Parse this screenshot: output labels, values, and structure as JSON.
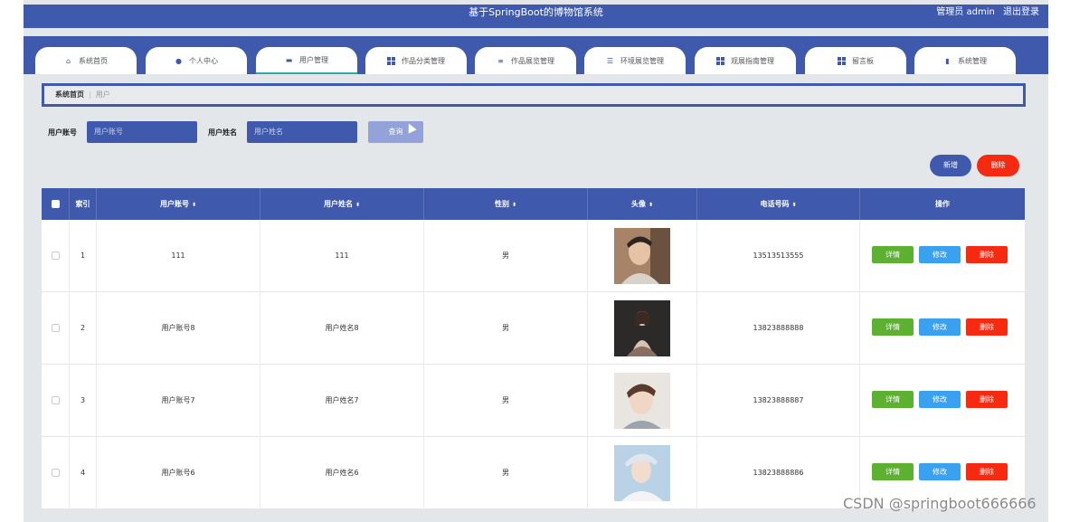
{
  "header": {
    "title": "基于SpringBoot的博物馆系统",
    "user_label": "管理员 admin",
    "logout": "退出登录"
  },
  "nav": {
    "tabs": [
      {
        "label": "系统首页",
        "icon": "home-icon"
      },
      {
        "label": "个人中心",
        "icon": "user-icon"
      },
      {
        "label": "用户管理",
        "icon": "briefcase-icon"
      },
      {
        "label": "作品分类管理",
        "icon": "grid-icon"
      },
      {
        "label": "作品展览管理",
        "icon": "list-icon"
      },
      {
        "label": "环境展览管理",
        "icon": "sliders-icon"
      },
      {
        "label": "观展指南管理",
        "icon": "grid-icon"
      },
      {
        "label": "留言板",
        "icon": "grid-icon"
      },
      {
        "label": "系统管理",
        "icon": "chart-icon"
      }
    ],
    "active_index": 2
  },
  "breadcrumb": {
    "home": "系统首页",
    "current": "用户"
  },
  "search": {
    "account_label": "用户账号",
    "account_placeholder": "用户账号",
    "name_label": "用户姓名",
    "name_placeholder": "用户姓名",
    "query_label": "查询"
  },
  "actions": {
    "add_label": "新增",
    "delete_label": "删除"
  },
  "table": {
    "headers": {
      "index": "索引",
      "account": "用户账号",
      "name": "用户姓名",
      "gender": "性别",
      "avatar": "头像",
      "phone": "电话号码",
      "ops": "操作"
    },
    "sort_symbol": "⬍",
    "rows": [
      {
        "index": "1",
        "account": "111",
        "name": "111",
        "gender": "男",
        "phone": "13513513555"
      },
      {
        "index": "2",
        "account": "用户账号8",
        "name": "用户姓名8",
        "gender": "男",
        "phone": "13823888888"
      },
      {
        "index": "3",
        "account": "用户账号7",
        "name": "用户姓名7",
        "gender": "男",
        "phone": "13823888887"
      },
      {
        "index": "4",
        "account": "用户账号6",
        "name": "用户姓名6",
        "gender": "男",
        "phone": "13823888886"
      }
    ],
    "row_ops": {
      "detail": "详情",
      "edit": "修改",
      "delete": "删除"
    }
  },
  "watermark": "CSDN @springboot666666",
  "colors": {
    "primary": "#3f5aac",
    "danger": "#f52a10",
    "success": "#5cb131",
    "info": "#3aa0f0"
  }
}
